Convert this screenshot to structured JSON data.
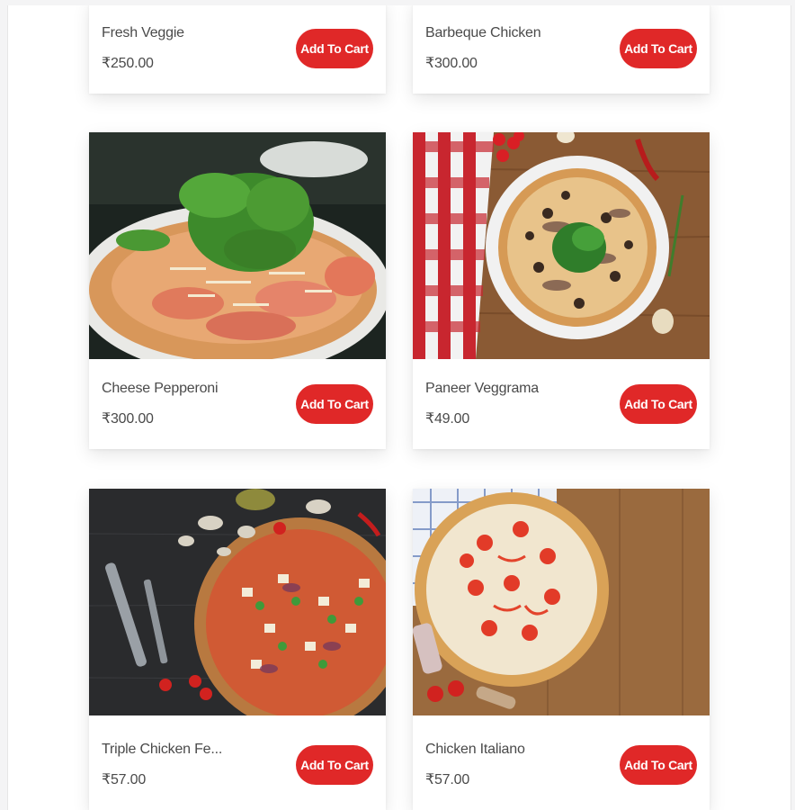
{
  "products": [
    {
      "name": "Fresh Veggie",
      "price": "₹250.00",
      "button": "Add To Cart",
      "image": "fresh-veggie-pizza"
    },
    {
      "name": "Barbeque Chicken",
      "price": "₹300.00",
      "button": "Add To Cart",
      "image": "barbeque-chicken-pizza"
    },
    {
      "name": "Cheese Pepperoni",
      "price": "₹300.00",
      "button": "Add To Cart",
      "image": "cheese-pepperoni-pizza"
    },
    {
      "name": "Paneer Veggrama",
      "price": "₹49.00",
      "button": "Add To Cart",
      "image": "paneer-veggrama-pizza"
    },
    {
      "name": "Triple Chicken Fe...",
      "price": "₹57.00",
      "button": "Add To Cart",
      "image": "triple-chicken-feast-pizza"
    },
    {
      "name": "Chicken Italiano",
      "price": "₹57.00",
      "button": "Add To Cart",
      "image": "chicken-italiano-pizza"
    }
  ],
  "colors": {
    "button": "#e02828",
    "text": "#4a4a4a",
    "card": "#ffffff"
  }
}
